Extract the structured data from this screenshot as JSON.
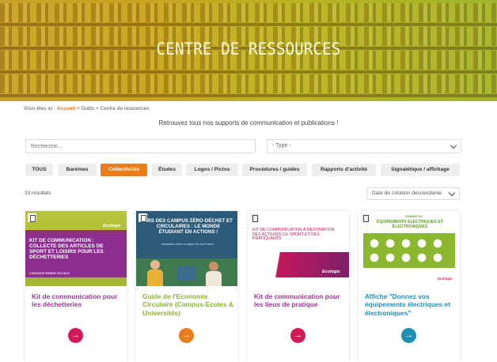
{
  "hero": {
    "title": "CENTRE DE RESSOURCES"
  },
  "breadcrumb": {
    "prefix": "Vous êtes ici :",
    "home": "Accueil",
    "sep1": ">",
    "tools": "Outils",
    "sep2": ">",
    "current": "Centre de ressources"
  },
  "intro": "Retrouvez tous nos supports de communication et publications !",
  "search": {
    "placeholder": "Recherche..."
  },
  "type_select": {
    "value": "- Type -"
  },
  "filters": [
    "TOUS",
    "Barèmes",
    "Collectivités",
    "Études",
    "Logos / Pictos",
    "Procédures / guides",
    "Rapports d'activité",
    "Signalétique / affichage"
  ],
  "active_filter": "Collectivités",
  "results": "33 résultats",
  "sort": {
    "value": "Date de création descendante"
  },
  "colors": {
    "accent": "#ea7d19",
    "purple": "#9b3a94",
    "green": "#8cb22f",
    "teal": "#1f8fb5",
    "pink": "#d3195a"
  },
  "cards": [
    {
      "title": "Kit de communication pour les déchetteries",
      "thumb_text": "KIT DE COMMUNICATION : COLLECTE DES ARTICLES DE SPORT ET LOISIRS POUR LES DÉCHETTERIES",
      "thumb_brand": "Ecologic",
      "thumb_sub": "CONSIGNE REMISE SOCIALE"
    },
    {
      "title": "Guide de l'Economie Circulaire (Campus-Ecoles & Universités)",
      "thumb_text": "ERS DES CAMPUS ZÉRO-DÉCHET ET CIRCULAIRES : LE MONDE ÉTUDIANT EN ACTIONS !",
      "thumb_sub": "Illustration avec la région Île-de-France"
    },
    {
      "title": "Kit de communication pour les lieux de pratique",
      "thumb_text": "KIT DE COMMUNICATION À DESTINATION DES ACTEURS DU SPORT ET DES PRATIQUANTS",
      "thumb_brand": "Ecologic"
    },
    {
      "title": "Affiche \"Donnez vos équipements électriques et électroniques\"",
      "thumb_text": "ÉQUIPEMENTS ÉLECTRIQUES ET ÉLECTRONIQUES",
      "thumb_pre": "DONNEZ OU",
      "thumb_brand": "Ecologic"
    }
  ],
  "arrow": "→"
}
